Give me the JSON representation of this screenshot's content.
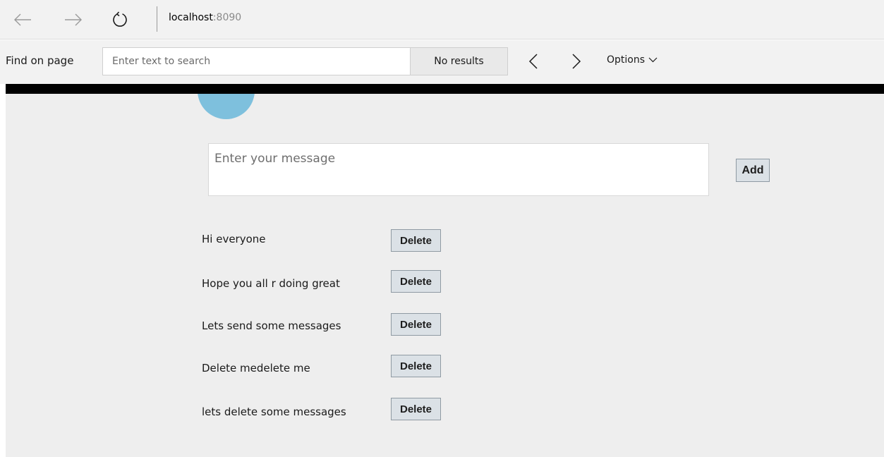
{
  "browser": {
    "url_host": "localhost",
    "url_port": ":8090"
  },
  "find_bar": {
    "label": "Find on page",
    "input_placeholder": "Enter text to search",
    "input_value": "",
    "results_text": "No results",
    "options_label": "Options"
  },
  "icons": {
    "back": "arrow-left-icon",
    "forward": "arrow-right-icon",
    "refresh": "refresh-icon",
    "find_prev": "chevron-left-icon",
    "find_next": "chevron-right-icon",
    "options_caret": "chevron-down-icon"
  },
  "colors": {
    "avatar": "#7ec0dd",
    "page_background": "#eeeeee",
    "button_background": "#dbe1e6"
  },
  "composer": {
    "placeholder": "Enter your message",
    "value": "",
    "add_label": "Add"
  },
  "messages": [
    {
      "text": "Hi everyone",
      "delete_label": "Delete"
    },
    {
      "text": "Hope you all r doing great",
      "delete_label": "Delete"
    },
    {
      "text": "Lets send some messages",
      "delete_label": "Delete"
    },
    {
      "text": "Delete medelete me",
      "delete_label": "Delete"
    },
    {
      "text": "lets delete some messages",
      "delete_label": "Delete"
    }
  ]
}
